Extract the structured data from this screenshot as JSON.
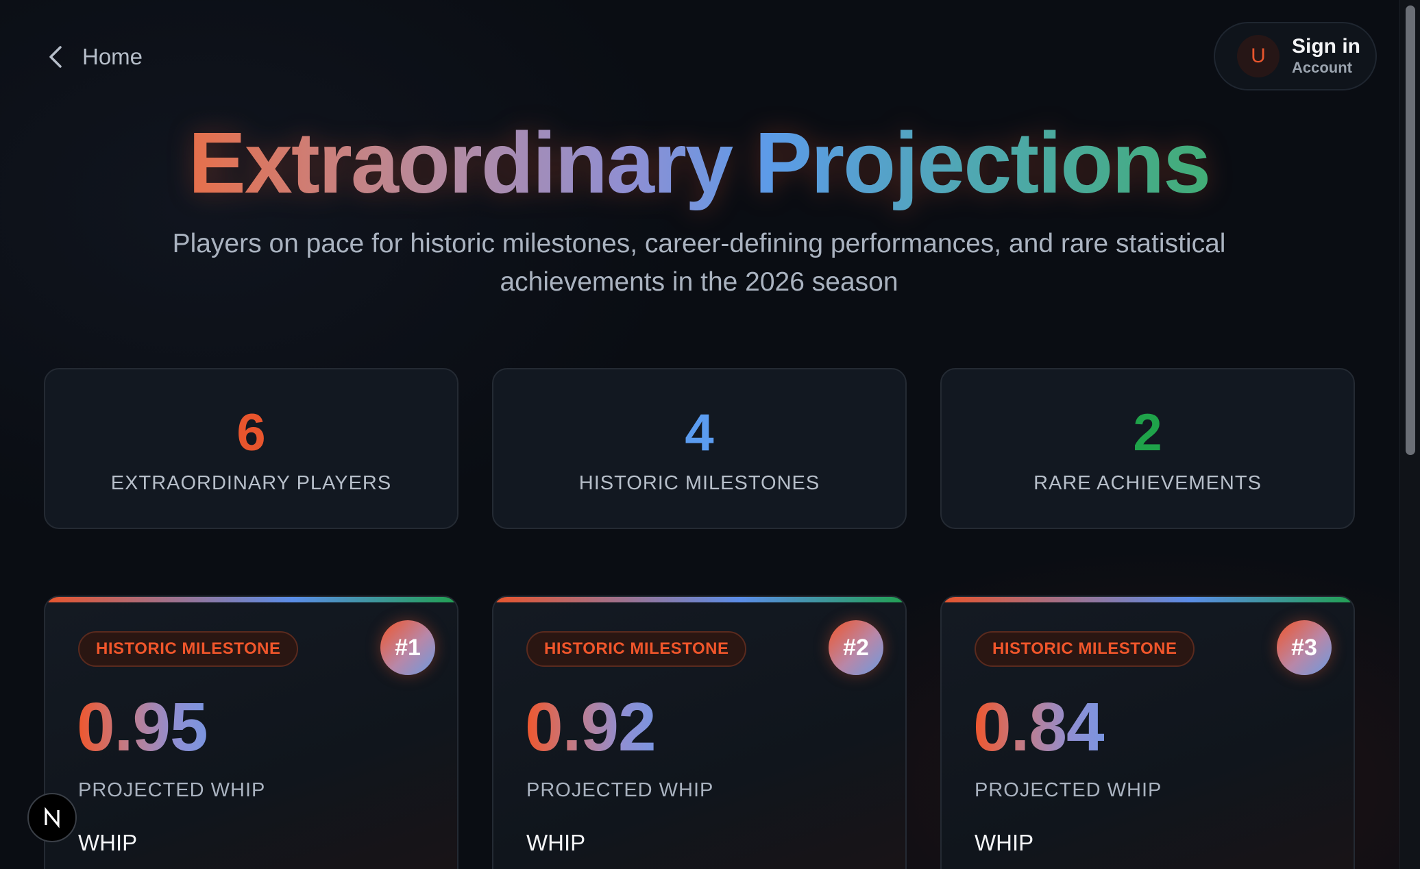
{
  "nav": {
    "back_label": "Home"
  },
  "account": {
    "initial": "U",
    "title": "Sign in",
    "subtitle": "Account"
  },
  "hero": {
    "title": "Extraordinary Projections",
    "subtitle": "Players on pace for historic milestones, career-defining performances, and rare statistical achievements in the 2026 season"
  },
  "stats": [
    {
      "value": "6",
      "label": "EXTRAORDINARY PLAYERS",
      "color": "#e8552d"
    },
    {
      "value": "4",
      "label": "HISTORIC MILESTONES",
      "color": "#5b9cf0"
    },
    {
      "value": "2",
      "label": "RARE ACHIEVEMENTS",
      "color": "#1fa34a"
    }
  ],
  "cards": [
    {
      "badge": "HISTORIC MILESTONE",
      "rank": "#1",
      "value": "0.95",
      "label": "PROJECTED WHIP",
      "stat": "WHIP"
    },
    {
      "badge": "HISTORIC MILESTONE",
      "rank": "#2",
      "value": "0.92",
      "label": "PROJECTED WHIP",
      "stat": "WHIP"
    },
    {
      "badge": "HISTORIC MILESTONE",
      "rank": "#3",
      "value": "0.84",
      "label": "PROJECTED WHIP",
      "stat": "WHIP"
    }
  ],
  "colors": {
    "accent_orange": "#e8552d",
    "accent_blue": "#5b9cf0",
    "accent_green": "#1fa34a",
    "background": "#0a0d13"
  },
  "icons": {
    "back": "chevron-left-icon",
    "floating": "n-logo-icon"
  }
}
